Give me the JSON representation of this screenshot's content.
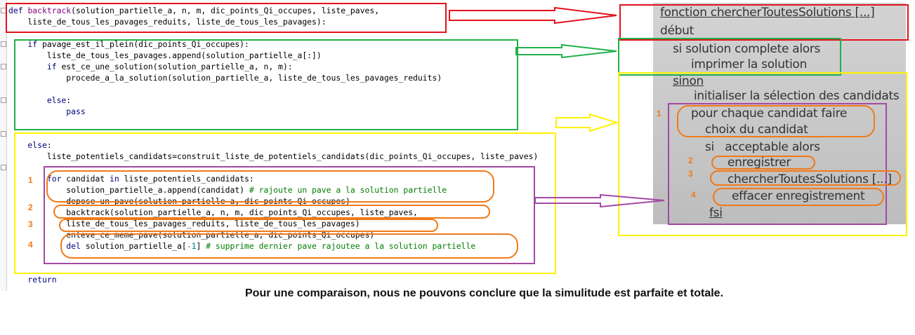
{
  "code": {
    "lines": [
      [
        [
          "kw",
          "def "
        ],
        [
          "fn",
          "backtrack"
        ],
        [
          "t",
          "(solution_partielle_a, n, m, dic_points_Qi_occupes, liste_paves,"
        ]
      ],
      [
        [
          "t",
          "    liste_de_tous_les_pavages_reduits, liste_de_tous_les_pavages):"
        ]
      ],
      [
        [
          "t",
          ""
        ]
      ],
      [
        [
          "kw",
          "    if "
        ],
        [
          "t",
          "pavage_est_il_plein(dic_points_Qi_occupes):"
        ]
      ],
      [
        [
          "t",
          "        liste_de_tous_les_pavages.append(solution_partielle_a[:])"
        ]
      ],
      [
        [
          "kw",
          "        if "
        ],
        [
          "t",
          "est_ce_une_solution(solution_partielle_a, n, m):"
        ]
      ],
      [
        [
          "t",
          "            procede_a_la_solution(solution_partielle_a, liste_de_tous_les_pavages_reduits)"
        ]
      ],
      [
        [
          "t",
          ""
        ]
      ],
      [
        [
          "kw",
          "        else"
        ],
        [
          "t",
          ":"
        ]
      ],
      [
        [
          "kw",
          "            pass"
        ]
      ],
      [
        [
          "t",
          ""
        ]
      ],
      [
        [
          "t",
          ""
        ]
      ],
      [
        [
          "kw",
          "    else"
        ],
        [
          "t",
          ":"
        ]
      ],
      [
        [
          "t",
          "        liste_potentiels_candidats=construit_liste_de_potentiels_candidats(dic_points_Qi_occupes, liste_paves)"
        ]
      ],
      [
        [
          "t",
          ""
        ]
      ],
      [
        [
          "kw",
          "        for "
        ],
        [
          "t",
          "candidat "
        ],
        [
          "kw",
          "in "
        ],
        [
          "t",
          "liste_potentiels_candidats:"
        ]
      ],
      [
        [
          "t",
          "            solution_partielle_a.append(candidat) "
        ],
        [
          "cm",
          "# rajoute un pave a la solution partielle"
        ]
      ],
      [
        [
          "t",
          "            depose_un_pave(solution_partielle_a, dic_points_Qi_occupes)"
        ]
      ],
      [
        [
          "t",
          "            backtrack(solution_partielle_a, n, m, dic_points_Qi_occupes, liste_paves,"
        ]
      ],
      [
        [
          "t",
          "            liste_de_tous_les_pavages_reduits, liste_de_tous_les_pavages)"
        ]
      ],
      [
        [
          "t",
          "            enleve_ce_meme_pave(solution_partielle_a, dic_points_Qi_occupes)"
        ]
      ],
      [
        [
          "kw",
          "            del "
        ],
        [
          "t",
          "solution_partielle_a["
        ],
        [
          "num",
          "-1"
        ],
        [
          "t",
          "] "
        ],
        [
          "cm",
          "# supprime dernier pave rajoutee a la solution partielle"
        ]
      ],
      [
        [
          "t",
          ""
        ]
      ],
      [
        [
          "t",
          ""
        ]
      ],
      [
        [
          "kw",
          "    return"
        ]
      ]
    ]
  },
  "labels": [
    "1",
    "2",
    "3",
    "4"
  ],
  "pseudocode": [
    "fonction chercherToutesSolutions [...]",
    "début",
    "si solution complete alors",
    "imprimer la solution",
    "sinon",
    "initialiser la sélection des candidats",
    "pour chaque candidat faire",
    "choix du candidat",
    "si   acceptable alors",
    "enregistrer",
    "chercherToutesSolutions [...]",
    "effacer enregistrement",
    "fsi"
  ],
  "note": "Pour une comparaison, nous ne pouvons conclure que la simulitude est parfaite et totale.",
  "colors": {
    "red": "#e2121c",
    "green": "#22b04a",
    "yellow": "#fff200",
    "purple": "#a349a4",
    "orange": "#f07a1a",
    "keyword": "#00007f",
    "function": "#7f007f",
    "comment": "#007f00"
  }
}
